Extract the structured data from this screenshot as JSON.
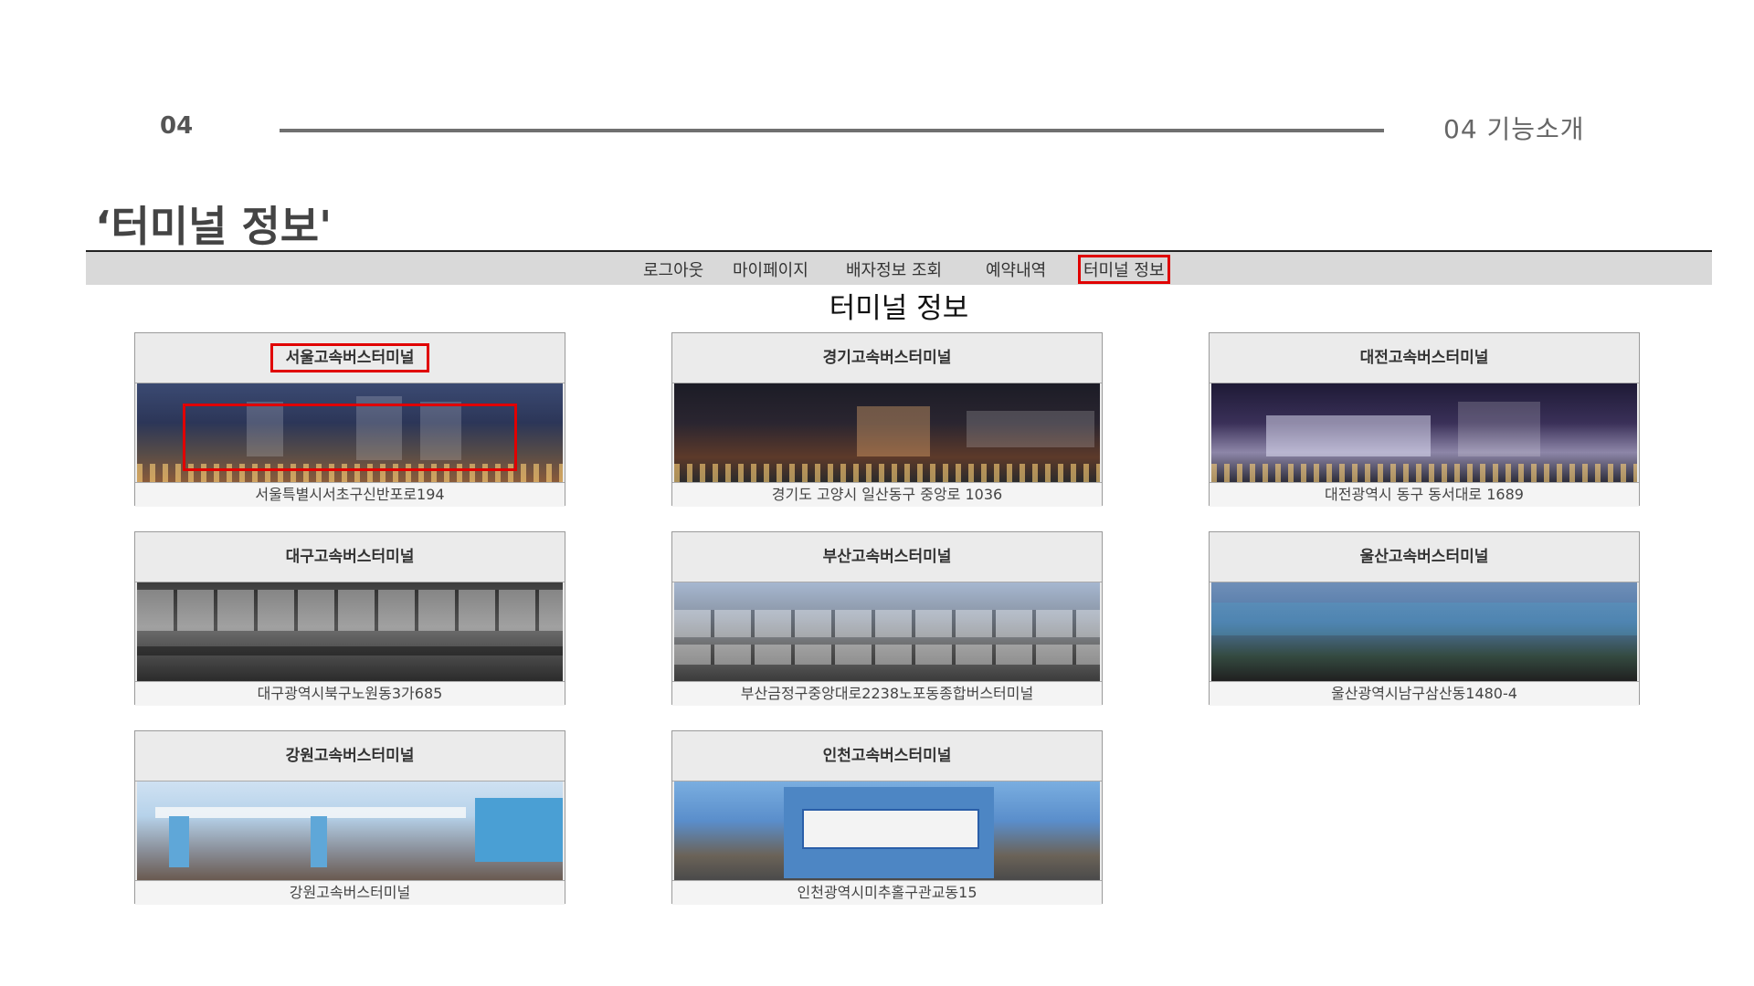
{
  "slide": {
    "number": "04",
    "section_label": "04  기능소개",
    "title": "‘터미널 정보'"
  },
  "nav": {
    "items": [
      "로그아웃",
      "마이페이지",
      "배자정보 조회",
      "예약내역",
      "터미널 정보"
    ],
    "active_index": 4
  },
  "page": {
    "heading": "터미널 정보"
  },
  "terminals": [
    {
      "name": "서울고속버스터미널",
      "address": "서울특별시서초구신반포로194"
    },
    {
      "name": "경기고속버스터미널",
      "address": "경기도 고양시 일산동구 중앙로 1036"
    },
    {
      "name": "대전고속버스터미널",
      "address": "대전광역시 동구 동서대로 1689"
    },
    {
      "name": "대구고속버스터미널",
      "address": "대구광역시북구노원동3가685"
    },
    {
      "name": "부산고속버스터미널",
      "address": "부산금정구중앙대로2238노포동종합버스터미널"
    },
    {
      "name": "울산고속버스터미널",
      "address": "울산광역시남구삼산동1480-4"
    },
    {
      "name": "강원고속버스터미널",
      "address": "강원고속버스터미널"
    },
    {
      "name": "인천고속버스터미널",
      "address": "인천광역시미추홀구관교동15"
    }
  ],
  "colors": {
    "highlight": "#e00000",
    "navbar": "#d9d9d9",
    "card_bg": "#ebebeb"
  }
}
